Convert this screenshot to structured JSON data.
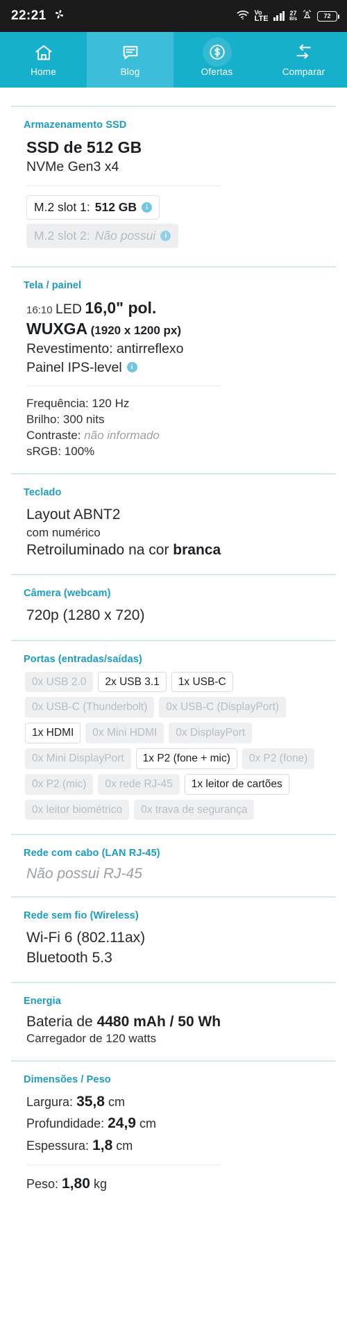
{
  "status_bar": {
    "clock": "22:21",
    "app_icon": "pinwheel-icon",
    "wifi_icon": "wifi-icon",
    "volte_top": "Vo",
    "volte_bottom": "LTE",
    "signal_icon": "signal-bars-icon",
    "net_speed_value": "27",
    "net_speed_unit": "B/s",
    "alarm_icon": "alarm-icon",
    "battery_level": "72"
  },
  "topnav": {
    "active": "Blog",
    "items": [
      {
        "label": "Home",
        "icon": "home-icon"
      },
      {
        "label": "Blog",
        "icon": "chat-bubble-icon"
      },
      {
        "label": "Ofertas",
        "icon": "dollar-circle-icon"
      },
      {
        "label": "Comparar",
        "icon": "compare-arrows-icon"
      }
    ]
  },
  "sections": {
    "storage": {
      "title": "Armazenamento SSD",
      "headline": "SSD de 512 GB",
      "subline": "NVMe Gen3 x4",
      "slots": [
        {
          "label": "M.2 slot 1:",
          "value": "512 GB",
          "state": "on"
        },
        {
          "label": "M.2 slot 2:",
          "value": "Não possui",
          "state": "off"
        }
      ]
    },
    "display": {
      "title": "Tela / painel",
      "ratio": "16:10",
      "tech": "LED",
      "size": "16,0\" pol.",
      "resolution_name": "WUXGA",
      "resolution_px": "(1920 x 1200 px)",
      "coating": "Revestimento: antirreflexo",
      "panel": "Painel IPS-level",
      "refresh": "Frequência: 120 Hz",
      "brightness": "Brilho: 300 nits",
      "contrast_label": "Contraste:",
      "contrast_value": "não informado",
      "srgb": "sRGB: 100%"
    },
    "keyboard": {
      "title": "Teclado",
      "layout": "Layout ABNT2",
      "numeric": "com numérico",
      "backlight_prefix": "Retroiluminado na cor",
      "backlight_color": "branca"
    },
    "camera": {
      "title": "Câmera (webcam)",
      "value": "720p (1280 x 720)"
    },
    "ports": {
      "title": "Portas (entradas/saídas)",
      "chips": [
        {
          "label": "0x USB 2.0",
          "state": "off"
        },
        {
          "label": "2x USB 3.1",
          "state": "on"
        },
        {
          "label": "1x USB-C",
          "state": "on"
        },
        {
          "label": "0x USB-C (Thunderbolt)",
          "state": "off"
        },
        {
          "label": "0x USB-C (DisplayPort)",
          "state": "off"
        },
        {
          "label": "1x HDMI",
          "state": "on"
        },
        {
          "label": "0x Mini HDMI",
          "state": "off"
        },
        {
          "label": "0x DisplayPort",
          "state": "off"
        },
        {
          "label": "0x Mini DisplayPort",
          "state": "off"
        },
        {
          "label": "1x P2 (fone + mic)",
          "state": "on"
        },
        {
          "label": "0x P2 (fone)",
          "state": "off"
        },
        {
          "label": "0x P2 (mic)",
          "state": "off"
        },
        {
          "label": "0x rede RJ-45",
          "state": "off"
        },
        {
          "label": "1x leitor de cartões",
          "state": "on"
        },
        {
          "label": "0x leitor biométrico",
          "state": "off"
        },
        {
          "label": "0x trava de segurança",
          "state": "off"
        }
      ]
    },
    "lan": {
      "title": "Rede com cabo (LAN RJ-45)",
      "value": "Não possui RJ-45"
    },
    "wireless": {
      "title": "Rede sem fio (Wireless)",
      "wifi": "Wi-Fi 6 (802.11ax)",
      "bluetooth": "Bluetooth 5.3"
    },
    "power": {
      "title": "Energia",
      "battery_prefix": "Bateria de",
      "battery_value": "4480 mAh / 50 Wh",
      "charger": "Carregador de 120 watts"
    },
    "dimensions": {
      "title": "Dimensões / Peso",
      "width_label": "Largura:",
      "width_value": "35,8",
      "width_unit": "cm",
      "depth_label": "Profundidade:",
      "depth_value": "24,9",
      "depth_unit": "cm",
      "thickness_label": "Espessura:",
      "thickness_value": "1,8",
      "thickness_unit": "cm",
      "weight_label": "Peso:",
      "weight_value": "1,80",
      "weight_unit": "kg"
    }
  },
  "colors": {
    "brand": "#17b0cc",
    "brand_active": "#3cbedb",
    "section_title": "#1b9cc4",
    "rule": "#cfe9ee"
  }
}
